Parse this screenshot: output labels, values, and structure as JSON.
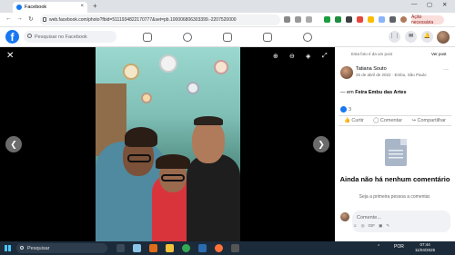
{
  "browser": {
    "tab_title": "Facebook",
    "tab_close": "×",
    "new_tab": "+",
    "url": "web.facebook.com/photo?fbid=5111934822170777&set=pb.100006806303399.-2207520000",
    "update_label": "Ação necessária",
    "back": "←",
    "forward": "→",
    "reload": "↻",
    "minimize": "—",
    "maximize": "▢",
    "close": "✕"
  },
  "facebook": {
    "logo": "f",
    "search_placeholder": "Pesquisar no Facebook",
    "menu_icon": "⋮⋮",
    "messenger_icon": "✉",
    "notifications_icon": "🔔"
  },
  "viewer": {
    "close": "✕",
    "zoom_in": "⊕",
    "zoom_out": "⊖",
    "tag": "◈",
    "fullscreen": "⤢",
    "prev": "❮",
    "next": "❯"
  },
  "panel": {
    "top_notice": "Esta foto é da um post",
    "view_post": "Ver post",
    "author": "Tatiana Souto",
    "meta": "25 de abril de 2022 · Embu, São Paulo",
    "location_prefix": "— em",
    "location": "Feira Embu das Artes",
    "reaction_count": "3",
    "like_label": "Curtir",
    "comment_label": "Comentar",
    "share_label": "Compartilhar",
    "no_comments": "Ainda não há nenhum comentário",
    "first_comment": "Seja a primeira pessoa a comentar.",
    "comment_placeholder": "Comente...",
    "comment_tools": [
      "☺",
      "◎",
      "GIF",
      "▣",
      "✎"
    ],
    "more": "···"
  },
  "taskbar": {
    "search_placeholder": "Pesquisar",
    "lang": "POR",
    "time": "07:44",
    "date": "11/04/2025"
  },
  "colors": {
    "fb_blue": "#1877f2",
    "taskbar": "#1c2b3a"
  }
}
